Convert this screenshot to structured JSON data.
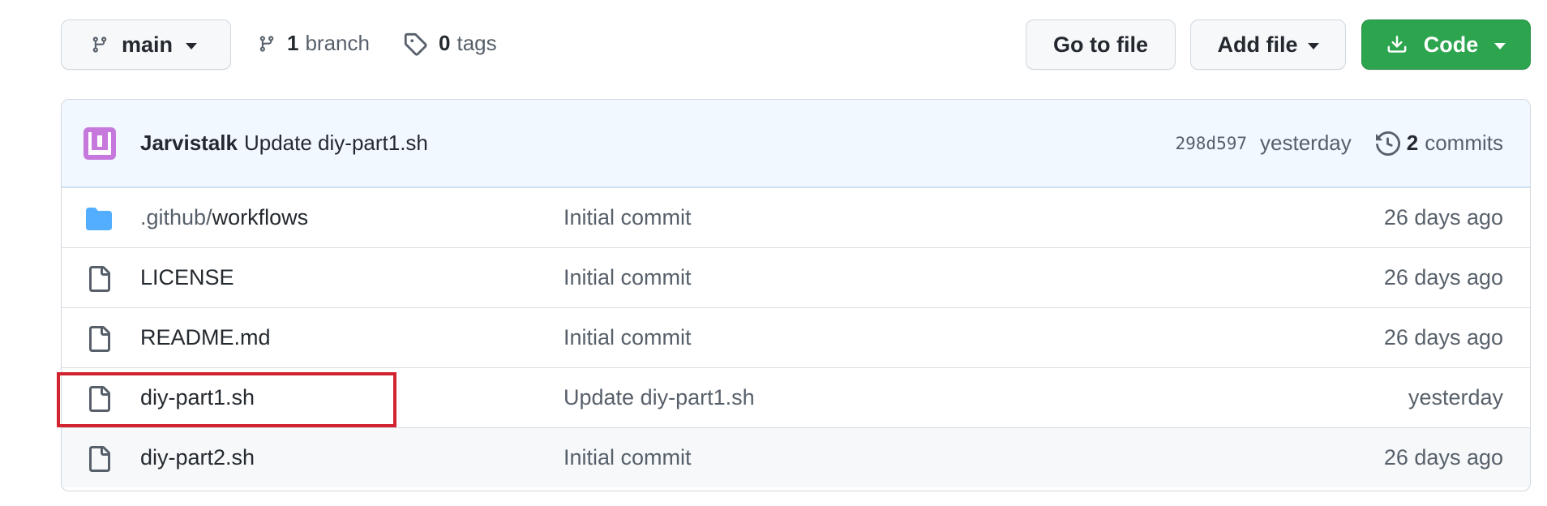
{
  "toolbar": {
    "branch_button": {
      "label": "main",
      "icon": "git-branch-icon"
    },
    "branches": {
      "count": "1",
      "label": "branch",
      "icon": "git-branch-icon"
    },
    "tags": {
      "count": "0",
      "label": "tags",
      "icon": "tag-icon"
    },
    "go_to_file": "Go to file",
    "add_file": "Add file",
    "code": {
      "label": "Code",
      "icon": "download-icon",
      "color": "#2da44e"
    }
  },
  "latest_commit": {
    "author": "Jarvistalk",
    "message": "Update diy-part1.sh",
    "sha": "298d597",
    "time": "yesterday",
    "commits_count": "2",
    "commits_label": "commits",
    "history_icon": "history-icon"
  },
  "files": [
    {
      "type": "directory",
      "dir_prefix": ".github/",
      "name": "workflows",
      "message": "Initial commit",
      "age": "26 days ago"
    },
    {
      "type": "file",
      "name": "LICENSE",
      "message": "Initial commit",
      "age": "26 days ago"
    },
    {
      "type": "file",
      "name": "README.md",
      "message": "Initial commit",
      "age": "26 days ago"
    },
    {
      "type": "file",
      "name": "diy-part1.sh",
      "message": "Update diy-part1.sh",
      "age": "yesterday"
    },
    {
      "type": "file",
      "name": "diy-part2.sh",
      "message": "Initial commit",
      "age": "26 days ago"
    }
  ],
  "colors": {
    "folder": "#54aeff",
    "highlight_box": "#d1242f",
    "commit_header_bg": "#f1f8ff"
  }
}
